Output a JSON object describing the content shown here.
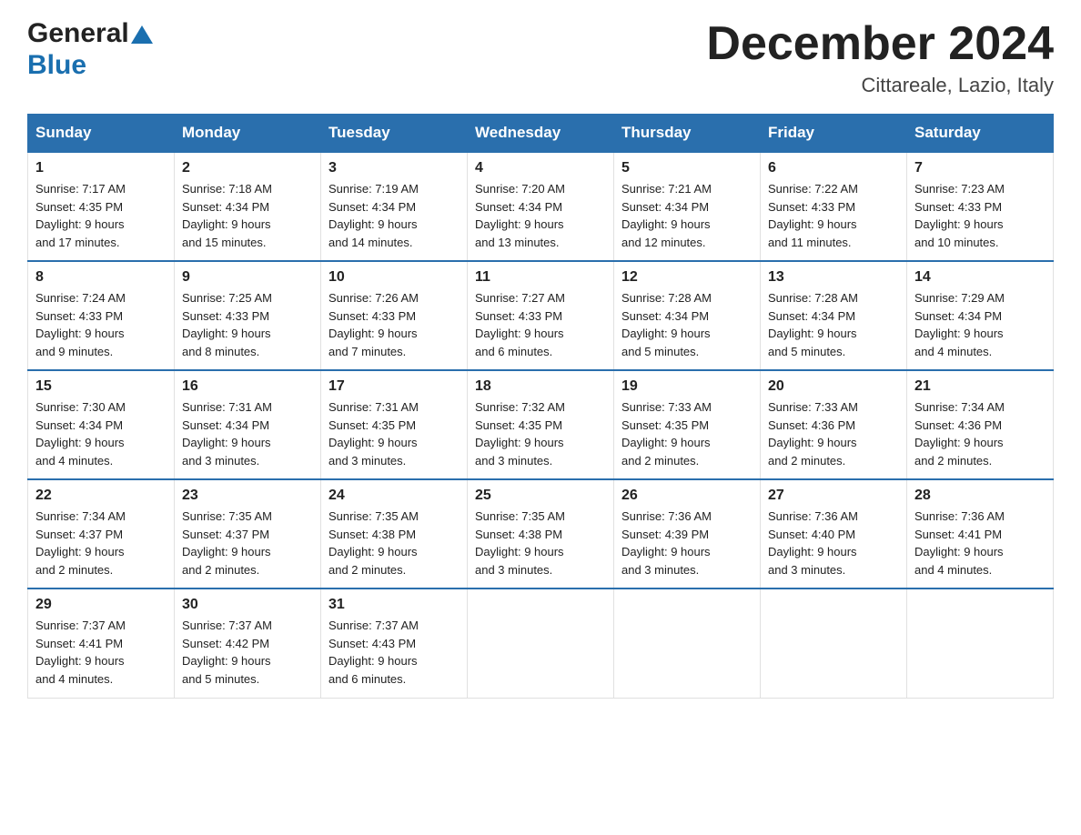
{
  "header": {
    "logo_general": "General",
    "logo_blue": "Blue",
    "title": "December 2024",
    "subtitle": "Cittareale, Lazio, Italy"
  },
  "days": [
    "Sunday",
    "Monday",
    "Tuesday",
    "Wednesday",
    "Thursday",
    "Friday",
    "Saturday"
  ],
  "weeks": [
    [
      {
        "num": "1",
        "sunrise": "7:17 AM",
        "sunset": "4:35 PM",
        "daylight": "9 hours and 17 minutes."
      },
      {
        "num": "2",
        "sunrise": "7:18 AM",
        "sunset": "4:34 PM",
        "daylight": "9 hours and 15 minutes."
      },
      {
        "num": "3",
        "sunrise": "7:19 AM",
        "sunset": "4:34 PM",
        "daylight": "9 hours and 14 minutes."
      },
      {
        "num": "4",
        "sunrise": "7:20 AM",
        "sunset": "4:34 PM",
        "daylight": "9 hours and 13 minutes."
      },
      {
        "num": "5",
        "sunrise": "7:21 AM",
        "sunset": "4:34 PM",
        "daylight": "9 hours and 12 minutes."
      },
      {
        "num": "6",
        "sunrise": "7:22 AM",
        "sunset": "4:33 PM",
        "daylight": "9 hours and 11 minutes."
      },
      {
        "num": "7",
        "sunrise": "7:23 AM",
        "sunset": "4:33 PM",
        "daylight": "9 hours and 10 minutes."
      }
    ],
    [
      {
        "num": "8",
        "sunrise": "7:24 AM",
        "sunset": "4:33 PM",
        "daylight": "9 hours and 9 minutes."
      },
      {
        "num": "9",
        "sunrise": "7:25 AM",
        "sunset": "4:33 PM",
        "daylight": "9 hours and 8 minutes."
      },
      {
        "num": "10",
        "sunrise": "7:26 AM",
        "sunset": "4:33 PM",
        "daylight": "9 hours and 7 minutes."
      },
      {
        "num": "11",
        "sunrise": "7:27 AM",
        "sunset": "4:33 PM",
        "daylight": "9 hours and 6 minutes."
      },
      {
        "num": "12",
        "sunrise": "7:28 AM",
        "sunset": "4:34 PM",
        "daylight": "9 hours and 5 minutes."
      },
      {
        "num": "13",
        "sunrise": "7:28 AM",
        "sunset": "4:34 PM",
        "daylight": "9 hours and 5 minutes."
      },
      {
        "num": "14",
        "sunrise": "7:29 AM",
        "sunset": "4:34 PM",
        "daylight": "9 hours and 4 minutes."
      }
    ],
    [
      {
        "num": "15",
        "sunrise": "7:30 AM",
        "sunset": "4:34 PM",
        "daylight": "9 hours and 4 minutes."
      },
      {
        "num": "16",
        "sunrise": "7:31 AM",
        "sunset": "4:34 PM",
        "daylight": "9 hours and 3 minutes."
      },
      {
        "num": "17",
        "sunrise": "7:31 AM",
        "sunset": "4:35 PM",
        "daylight": "9 hours and 3 minutes."
      },
      {
        "num": "18",
        "sunrise": "7:32 AM",
        "sunset": "4:35 PM",
        "daylight": "9 hours and 3 minutes."
      },
      {
        "num": "19",
        "sunrise": "7:33 AM",
        "sunset": "4:35 PM",
        "daylight": "9 hours and 2 minutes."
      },
      {
        "num": "20",
        "sunrise": "7:33 AM",
        "sunset": "4:36 PM",
        "daylight": "9 hours and 2 minutes."
      },
      {
        "num": "21",
        "sunrise": "7:34 AM",
        "sunset": "4:36 PM",
        "daylight": "9 hours and 2 minutes."
      }
    ],
    [
      {
        "num": "22",
        "sunrise": "7:34 AM",
        "sunset": "4:37 PM",
        "daylight": "9 hours and 2 minutes."
      },
      {
        "num": "23",
        "sunrise": "7:35 AM",
        "sunset": "4:37 PM",
        "daylight": "9 hours and 2 minutes."
      },
      {
        "num": "24",
        "sunrise": "7:35 AM",
        "sunset": "4:38 PM",
        "daylight": "9 hours and 2 minutes."
      },
      {
        "num": "25",
        "sunrise": "7:35 AM",
        "sunset": "4:38 PM",
        "daylight": "9 hours and 3 minutes."
      },
      {
        "num": "26",
        "sunrise": "7:36 AM",
        "sunset": "4:39 PM",
        "daylight": "9 hours and 3 minutes."
      },
      {
        "num": "27",
        "sunrise": "7:36 AM",
        "sunset": "4:40 PM",
        "daylight": "9 hours and 3 minutes."
      },
      {
        "num": "28",
        "sunrise": "7:36 AM",
        "sunset": "4:41 PM",
        "daylight": "9 hours and 4 minutes."
      }
    ],
    [
      {
        "num": "29",
        "sunrise": "7:37 AM",
        "sunset": "4:41 PM",
        "daylight": "9 hours and 4 minutes."
      },
      {
        "num": "30",
        "sunrise": "7:37 AM",
        "sunset": "4:42 PM",
        "daylight": "9 hours and 5 minutes."
      },
      {
        "num": "31",
        "sunrise": "7:37 AM",
        "sunset": "4:43 PM",
        "daylight": "9 hours and 6 minutes."
      },
      null,
      null,
      null,
      null
    ]
  ],
  "labels": {
    "sunrise": "Sunrise:",
    "sunset": "Sunset:",
    "daylight": "Daylight:"
  }
}
